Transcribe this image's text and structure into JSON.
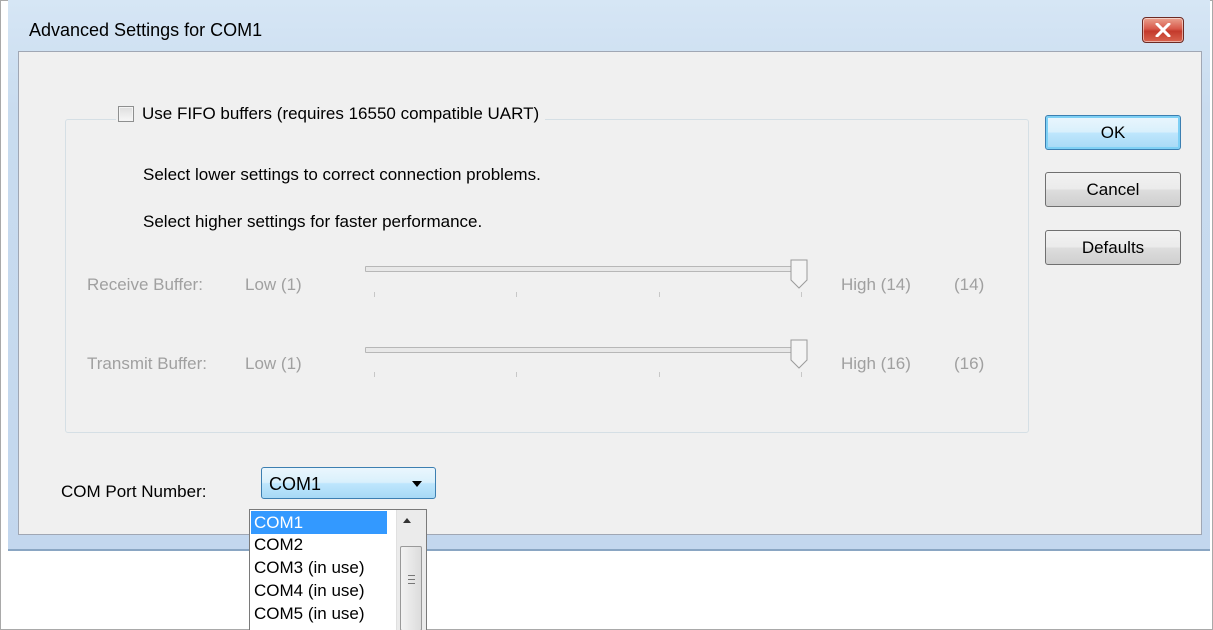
{
  "dialog": {
    "title": "Advanced Settings for COM1"
  },
  "fifo": {
    "label": "Use FIFO buffers (requires 16550 compatible UART)",
    "checked": false,
    "hint_lower": "Select lower settings to correct connection problems.",
    "hint_higher": "Select higher settings for faster performance."
  },
  "receive": {
    "label": "Receive Buffer:",
    "low": "Low (1)",
    "high": "High (14)",
    "current": "(14)",
    "level": 1.0
  },
  "transmit": {
    "label": "Transmit Buffer:",
    "low": "Low (1)",
    "high": "High (16)",
    "current": "(16)",
    "level": 1.0
  },
  "buttons": {
    "ok": "OK",
    "cancel": "Cancel",
    "defaults": "Defaults"
  },
  "port": {
    "label": "COM Port Number:",
    "selected": "COM1",
    "options": [
      "COM1",
      "COM2",
      "COM3 (in use)",
      "COM4 (in use)",
      "COM5 (in use)"
    ]
  },
  "colors": {
    "selection": "#3399ff",
    "disabled_text": "#a0a0a0",
    "close_button": "#c33a2c"
  },
  "icons": {
    "close": "close-icon",
    "dropdown": "chevron-down-icon",
    "scroll_up": "scroll-up-icon"
  }
}
